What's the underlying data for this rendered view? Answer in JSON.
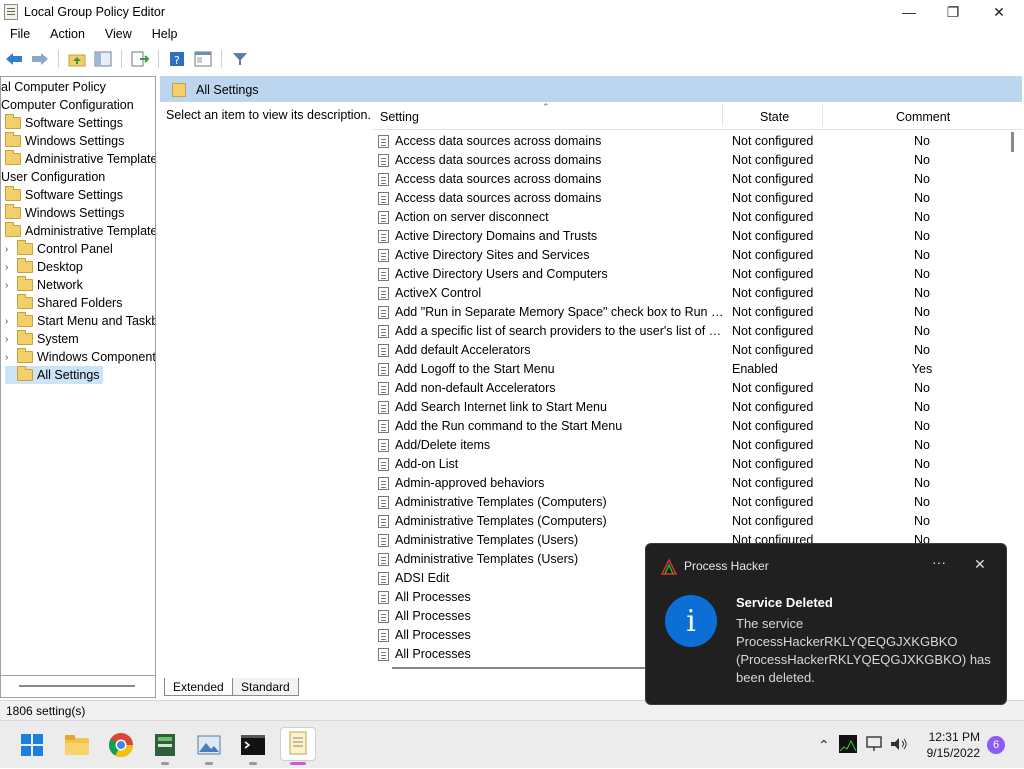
{
  "window": {
    "title": "Local Group Policy Editor"
  },
  "menu": [
    "File",
    "Action",
    "View",
    "Help"
  ],
  "tree": [
    {
      "label": "al Computer Policy",
      "indent": 0,
      "folder": false,
      "chevron": false
    },
    {
      "label": "Computer Configuration",
      "indent": 0,
      "folder": false,
      "chevron": false
    },
    {
      "label": "Software Settings",
      "indent": 1,
      "folder": true,
      "chevron": false
    },
    {
      "label": "Windows Settings",
      "indent": 1,
      "folder": true,
      "chevron": false
    },
    {
      "label": "Administrative Templates",
      "indent": 1,
      "folder": true,
      "chevron": false
    },
    {
      "label": "User Configuration",
      "indent": 0,
      "folder": false,
      "chevron": false
    },
    {
      "label": "Software Settings",
      "indent": 1,
      "folder": true,
      "chevron": false
    },
    {
      "label": "Windows Settings",
      "indent": 1,
      "folder": true,
      "chevron": false
    },
    {
      "label": "Administrative Templates",
      "indent": 1,
      "folder": true,
      "chevron": false
    },
    {
      "label": "Control Panel",
      "indent": 2,
      "folder": true,
      "chevron": true
    },
    {
      "label": "Desktop",
      "indent": 2,
      "folder": true,
      "chevron": true
    },
    {
      "label": "Network",
      "indent": 2,
      "folder": true,
      "chevron": true
    },
    {
      "label": "Shared Folders",
      "indent": 2,
      "folder": true,
      "chevron": false
    },
    {
      "label": "Start Menu and Taskba",
      "indent": 2,
      "folder": true,
      "chevron": true
    },
    {
      "label": "System",
      "indent": 2,
      "folder": true,
      "chevron": true
    },
    {
      "label": "Windows Component",
      "indent": 2,
      "folder": true,
      "chevron": true
    },
    {
      "label": "All Settings",
      "indent": 2,
      "folder": true,
      "chevron": false,
      "selected": true
    }
  ],
  "panel": {
    "header_title": "All Settings",
    "description": "Select an item to view its description.",
    "columns": {
      "setting": "Setting",
      "state": "State",
      "comment": "Comment"
    }
  },
  "rows": [
    {
      "setting": "Access data sources across domains",
      "state": "Not configured",
      "comment": "No"
    },
    {
      "setting": "Access data sources across domains",
      "state": "Not configured",
      "comment": "No"
    },
    {
      "setting": "Access data sources across domains",
      "state": "Not configured",
      "comment": "No"
    },
    {
      "setting": "Access data sources across domains",
      "state": "Not configured",
      "comment": "No"
    },
    {
      "setting": "Action on server disconnect",
      "state": "Not configured",
      "comment": "No"
    },
    {
      "setting": "Active Directory Domains and Trusts",
      "state": "Not configured",
      "comment": "No"
    },
    {
      "setting": "Active Directory Sites and Services",
      "state": "Not configured",
      "comment": "No"
    },
    {
      "setting": "Active Directory Users and Computers",
      "state": "Not configured",
      "comment": "No"
    },
    {
      "setting": "ActiveX Control",
      "state": "Not configured",
      "comment": "No"
    },
    {
      "setting": "Add \"Run in Separate Memory Space\" check box to Run dial...",
      "state": "Not configured",
      "comment": "No"
    },
    {
      "setting": "Add a specific list of search providers to the user's list of sea...",
      "state": "Not configured",
      "comment": "No"
    },
    {
      "setting": "Add default Accelerators",
      "state": "Not configured",
      "comment": "No"
    },
    {
      "setting": "Add Logoff to the Start Menu",
      "state": "Enabled",
      "comment": "Yes"
    },
    {
      "setting": "Add non-default Accelerators",
      "state": "Not configured",
      "comment": "No"
    },
    {
      "setting": "Add Search Internet link to Start Menu",
      "state": "Not configured",
      "comment": "No"
    },
    {
      "setting": "Add the Run command to the Start Menu",
      "state": "Not configured",
      "comment": "No"
    },
    {
      "setting": "Add/Delete items",
      "state": "Not configured",
      "comment": "No"
    },
    {
      "setting": "Add-on List",
      "state": "Not configured",
      "comment": "No"
    },
    {
      "setting": "Admin-approved behaviors",
      "state": "Not configured",
      "comment": "No"
    },
    {
      "setting": "Administrative Templates (Computers)",
      "state": "Not configured",
      "comment": "No"
    },
    {
      "setting": "Administrative Templates (Computers)",
      "state": "Not configured",
      "comment": "No"
    },
    {
      "setting": "Administrative Templates (Users)",
      "state": "Not configured",
      "comment": "No"
    },
    {
      "setting": "Administrative Templates (Users)",
      "state": "",
      "comment": ""
    },
    {
      "setting": "ADSI Edit",
      "state": "",
      "comment": ""
    },
    {
      "setting": "All Processes",
      "state": "",
      "comment": ""
    },
    {
      "setting": "All Processes",
      "state": "",
      "comment": ""
    },
    {
      "setting": "All Processes",
      "state": "",
      "comment": ""
    },
    {
      "setting": "All Processes",
      "state": "",
      "comment": ""
    }
  ],
  "tabs": {
    "extended": "Extended",
    "standard": "Standard"
  },
  "status": {
    "count": "1806 setting(s)"
  },
  "toast": {
    "app": "Process Hacker",
    "more": "···",
    "close": "✕",
    "heading": "Service Deleted",
    "body": "The service ProcessHackerRKLYQEQGJXKGBKO (ProcessHackerRKLYQEQGJXKGBKO) has been deleted."
  },
  "taskbar": {
    "time": "12:31 PM",
    "date": "9/15/2022",
    "badge": "6",
    "icons": [
      "windows-start-icon",
      "file-explorer-icon",
      "chrome-icon",
      "server-manager-icon",
      "image-viewer-icon",
      "terminal-icon",
      "notepad-icon"
    ]
  },
  "colors": {
    "accent": "#0b6fd6",
    "selection": "#cce4f7",
    "header": "#bcd6ef",
    "badge": "#8b5cf6"
  }
}
